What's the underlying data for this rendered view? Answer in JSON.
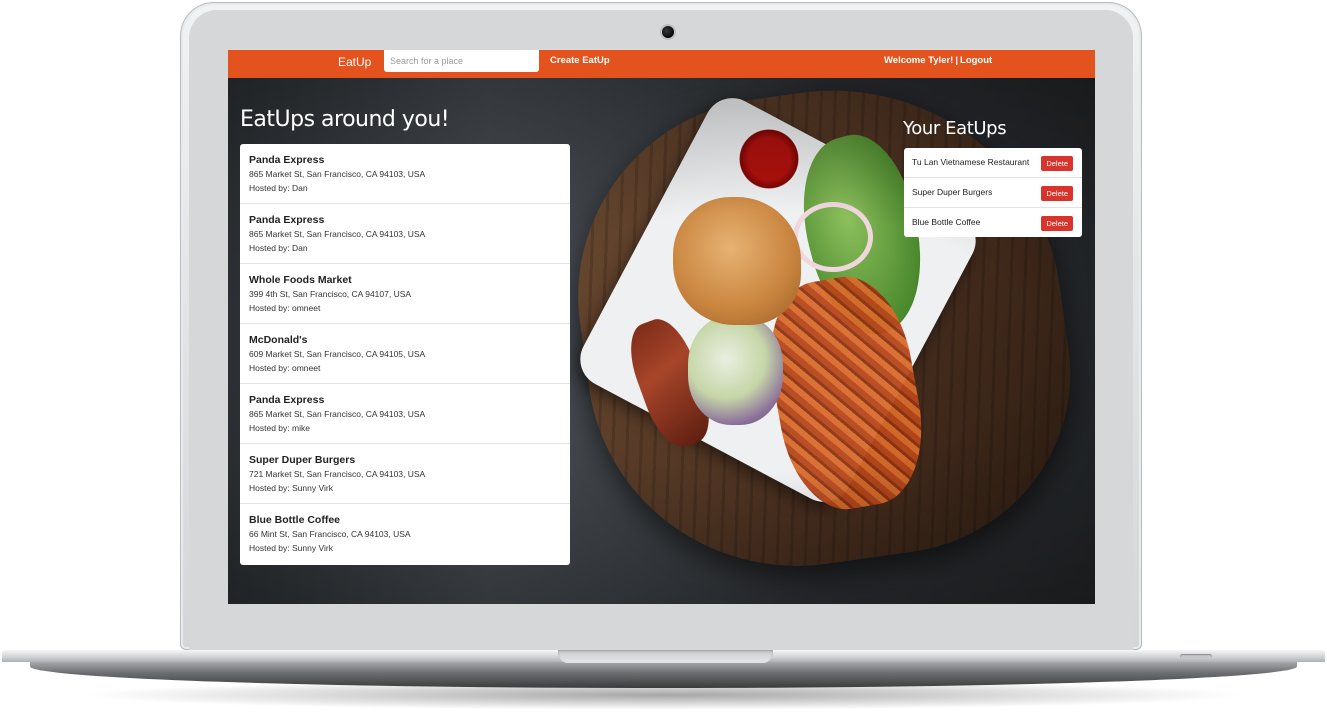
{
  "navbar": {
    "brand": "EatUp",
    "search_placeholder": "Search for a place",
    "create_link": "Create EatUp",
    "welcome": "Welcome Tyler!",
    "separator": "|",
    "logout": "Logout",
    "accent_color": "#e4521e"
  },
  "nearby": {
    "heading": "EatUps around you!",
    "items": [
      {
        "name": "Panda Express",
        "address": "865 Market St, San Francisco, CA 94103, USA",
        "host": "Hosted by: Dan"
      },
      {
        "name": "Panda Express",
        "address": "865 Market St, San Francisco, CA 94103, USA",
        "host": "Hosted by: Dan"
      },
      {
        "name": "Whole Foods Market",
        "address": "399 4th St, San Francisco, CA 94107, USA",
        "host": "Hosted by: omneet"
      },
      {
        "name": "McDonald's",
        "address": "609 Market St, San Francisco, CA 94105, USA",
        "host": "Hosted by: omneet"
      },
      {
        "name": "Panda Express",
        "address": "865 Market St, San Francisco, CA 94103, USA",
        "host": "Hosted by: mike"
      },
      {
        "name": "Super Duper Burgers",
        "address": "721 Market St, San Francisco, CA 94103, USA",
        "host": "Hosted by: Sunny Virk"
      },
      {
        "name": "Blue Bottle Coffee",
        "address": "66 Mint St, San Francisco, CA 94103, USA",
        "host": "Hosted by: Sunny Virk"
      }
    ]
  },
  "mine": {
    "heading": "Your EatUps",
    "delete_label": "Delete",
    "delete_color": "#d9342b",
    "items": [
      {
        "name": "Tu Lan Vietnamese Restaurant"
      },
      {
        "name": "Super Duper Burgers"
      },
      {
        "name": "Blue Bottle Coffee"
      }
    ]
  },
  "background": {
    "icon": "food-photo"
  }
}
